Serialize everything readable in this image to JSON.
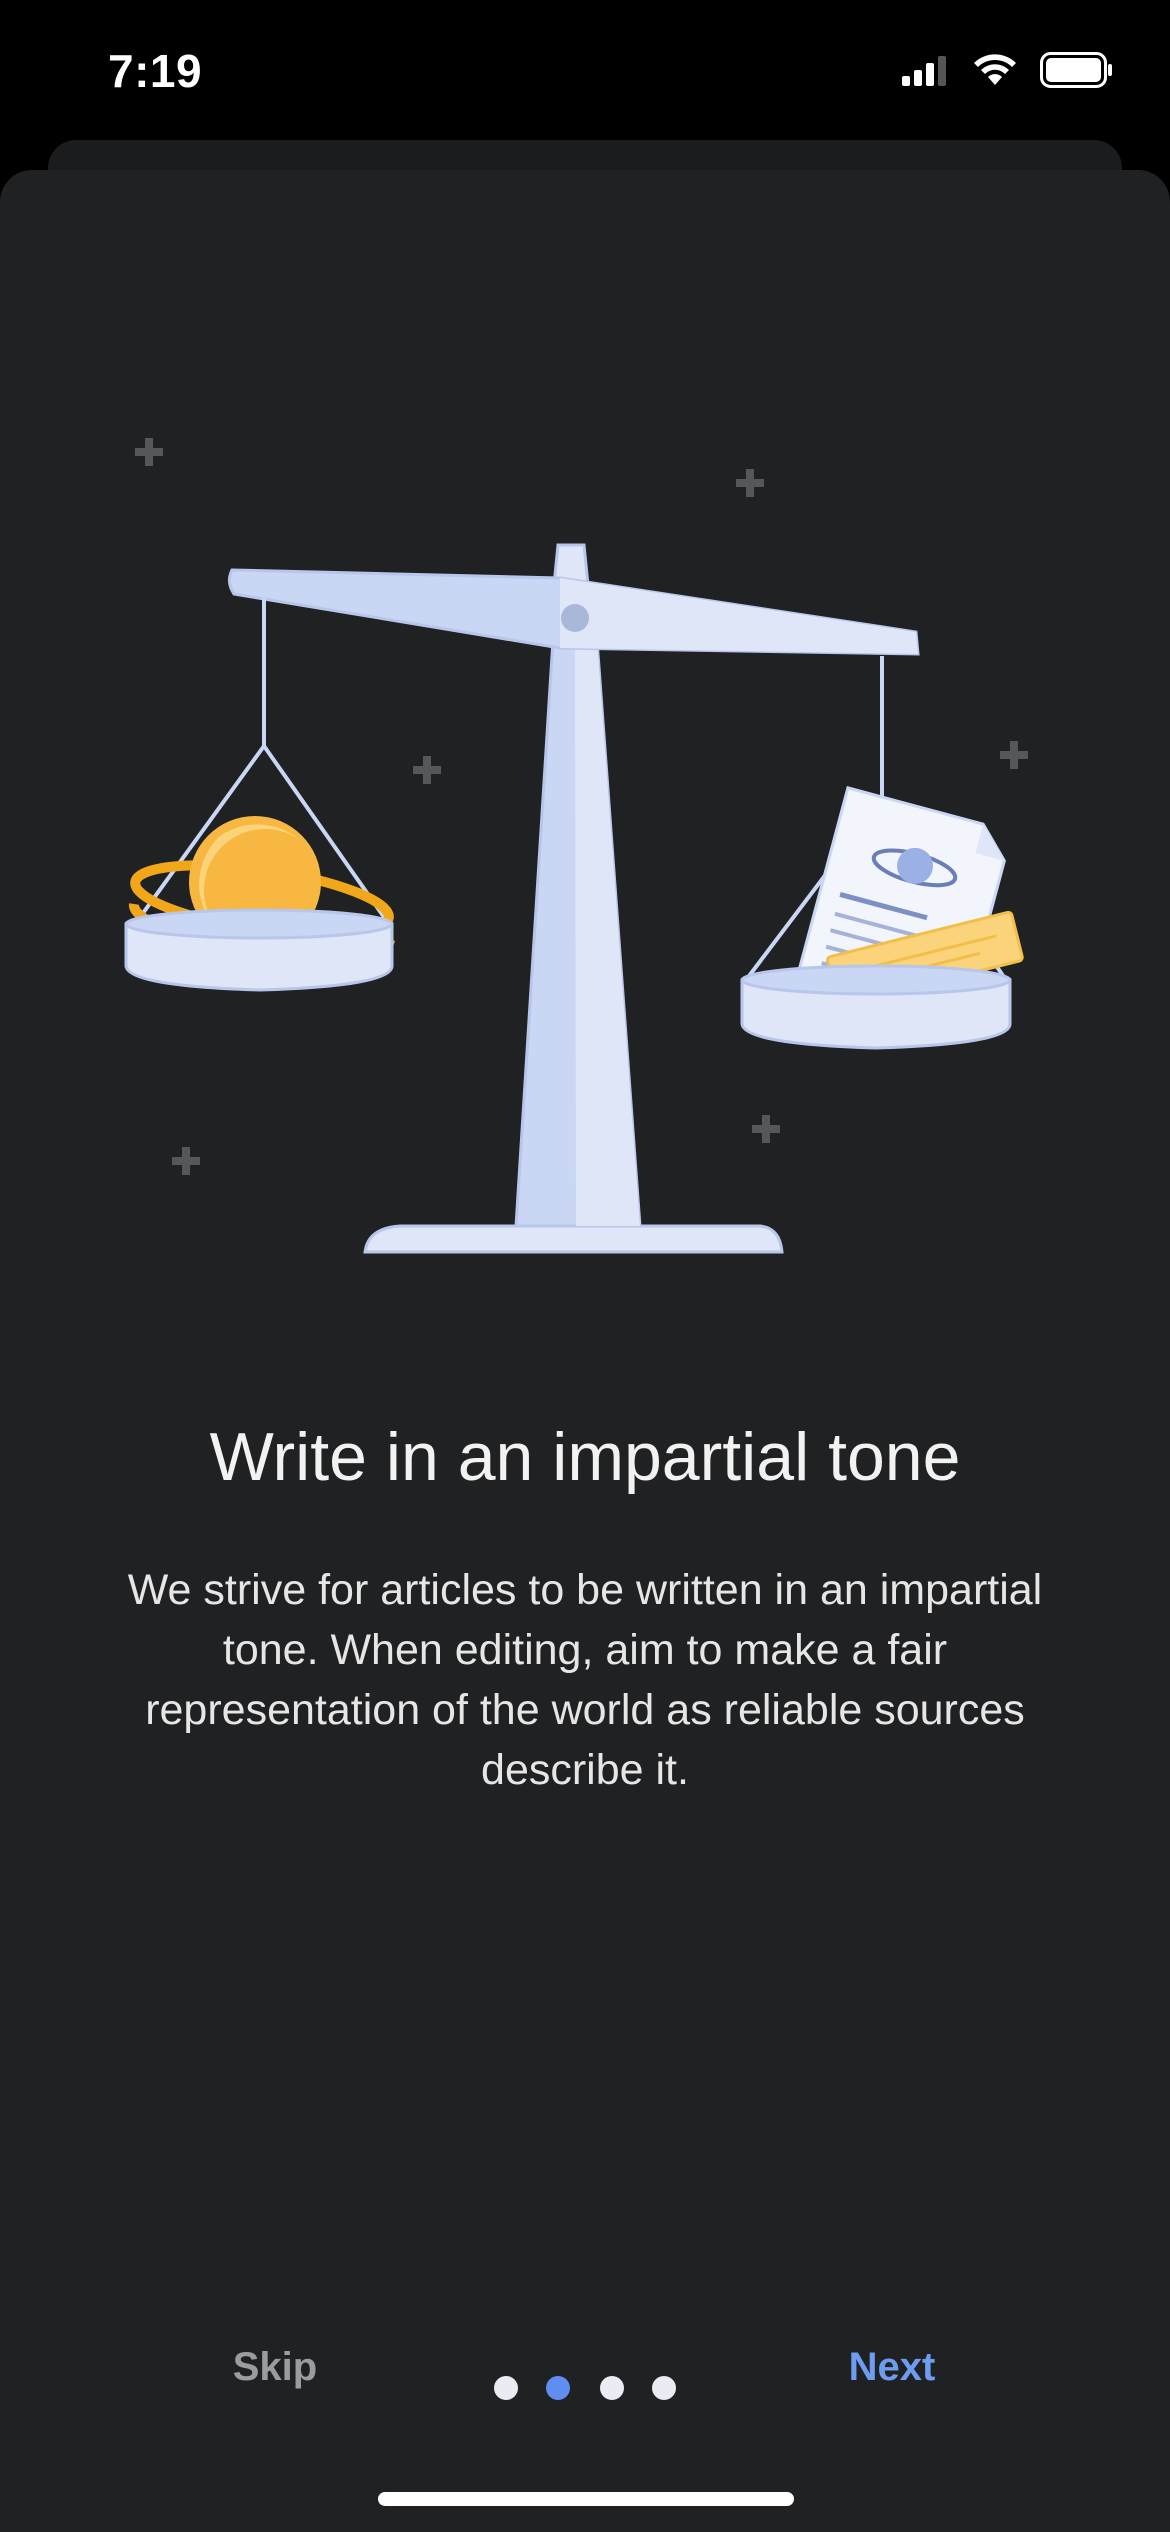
{
  "status_bar": {
    "time": "7:19",
    "icons": [
      "cellular-signal-icon",
      "wifi-icon",
      "battery-icon"
    ]
  },
  "onboarding": {
    "title": "Write in an impartial tone",
    "body": "We strive for articles to be written in an impartial tone. When editing, aim to make a fair representation of the world as reliable sources describe it.",
    "illustration": "balance-scale-illustration",
    "pager": {
      "total": 4,
      "current": 2
    }
  },
  "footer": {
    "skip_label": "Skip",
    "next_label": "Next"
  },
  "colors": {
    "background": "#202123",
    "accent": "#6d9cf0",
    "active_dot": "#5f8ef0",
    "secondary_text": "#9a9ca0"
  }
}
